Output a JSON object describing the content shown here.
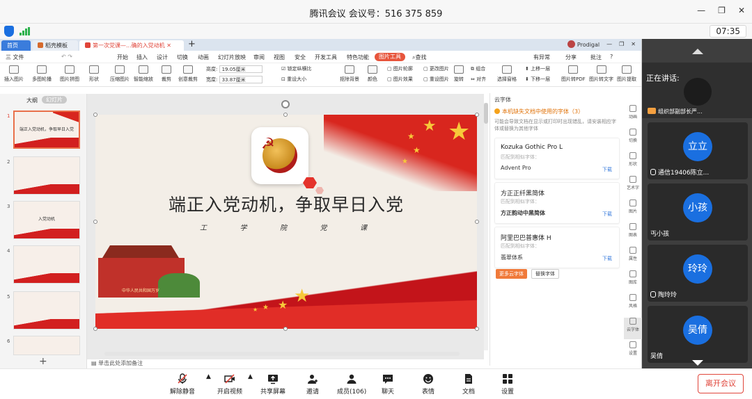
{
  "meeting": {
    "title": "腾讯会议 会议号：516 375 859",
    "timer": "07:35",
    "speaking_label": "正在讲话:",
    "speaker_name": "组织部副部长严...",
    "participants": [
      {
        "avatar": "立立",
        "name": "通信19406陈立..."
      },
      {
        "avatar": "小孩",
        "name": "丐小孩"
      },
      {
        "avatar": "玲玲",
        "name": "陶玲玲"
      },
      {
        "avatar": "吴倩",
        "name": "吴倩"
      }
    ],
    "leave_label": "离开会议"
  },
  "toolbar_bottom": [
    {
      "label": "解除静音",
      "icon": "mic-muted-icon"
    },
    {
      "label": "开启视频",
      "icon": "video-off-icon"
    },
    {
      "label": "共享屏幕",
      "icon": "share-screen-icon"
    },
    {
      "label": "邀请",
      "icon": "invite-icon"
    },
    {
      "label": "成员(106)",
      "icon": "members-icon"
    },
    {
      "label": "聊天",
      "icon": "chat-icon"
    },
    {
      "label": "表情",
      "icon": "emoji-icon"
    },
    {
      "label": "文档",
      "icon": "document-icon"
    },
    {
      "label": "设置",
      "icon": "settings-icon"
    }
  ],
  "wps": {
    "tabs": [
      "首页",
      "稻壳模板",
      "第一次党课—...确的入党动机"
    ],
    "user": "Prodigal",
    "menus": [
      "三 文件",
      "开始",
      "插入",
      "设计",
      "切换",
      "动画",
      "幻灯片放映",
      "审阅",
      "视图",
      "安全",
      "开发工具",
      "特色功能",
      "图片工具",
      "查找"
    ],
    "active_menu": "图片工具",
    "right_menu": [
      "有异常",
      "分享",
      "批注"
    ],
    "tools": [
      "插入图片",
      "多图轮播",
      "图片拼图",
      "形状",
      "压缩图片",
      "智能缩放",
      "裁剪",
      "创意裁剪",
      "抠除背景",
      "颜色",
      "图片效果",
      "旋转",
      "对齐",
      "选择窗格",
      "图片转PDF",
      "图片转文字",
      "图片提取"
    ],
    "tool_small": [
      "图片轮廓",
      "更改图片",
      "重设图片",
      "组合",
      "上移一层",
      "下移一层"
    ],
    "height_label": "高度:",
    "height_value": "19.05厘米",
    "width_label": "宽度:",
    "width_value": "33.87厘米",
    "lock_ratio": "锁定纵横比",
    "reset_size": "重设大小",
    "outline_tab": "大纲",
    "slides_tab": "幻灯片",
    "slide_numbers": [
      "1",
      "2",
      "3",
      "4",
      "5",
      "6"
    ],
    "thumb1_title": "端正入党动机，争取早日入党",
    "thumb3_title": "入党动机",
    "notes": "单击此处添加备注"
  },
  "slide": {
    "title": "端正入党动机，争取早日入党",
    "subtitle": [
      "工",
      "学",
      "院",
      "党",
      "课"
    ],
    "banner": "中华人民共和国万岁"
  },
  "font_panel": {
    "header": "云字体",
    "warning": "本机缺失文档中使用的字体（3）",
    "desc": "可能会导致文档在显示或打印时出现错乱，请安装相应字体或替换为其他字体",
    "match_label": "匹配到相似字体：",
    "download": "下载",
    "items": [
      {
        "name": "Kozuka Gothic Pro L",
        "replacement": "Advent Pro"
      },
      {
        "name": "方正正纤黑简体",
        "replacement": "方正韵动中黑简体"
      },
      {
        "name": "阿里巴巴普惠体 H",
        "replacement": "翡翠体系"
      }
    ],
    "more_button": "更多云字体",
    "replace_button": "替换字体"
  },
  "side_icons": [
    "动画",
    "切换",
    "形状",
    "艺术字",
    "图片",
    "图表",
    "属性",
    "图库",
    "风格",
    "云字体",
    "设置"
  ]
}
